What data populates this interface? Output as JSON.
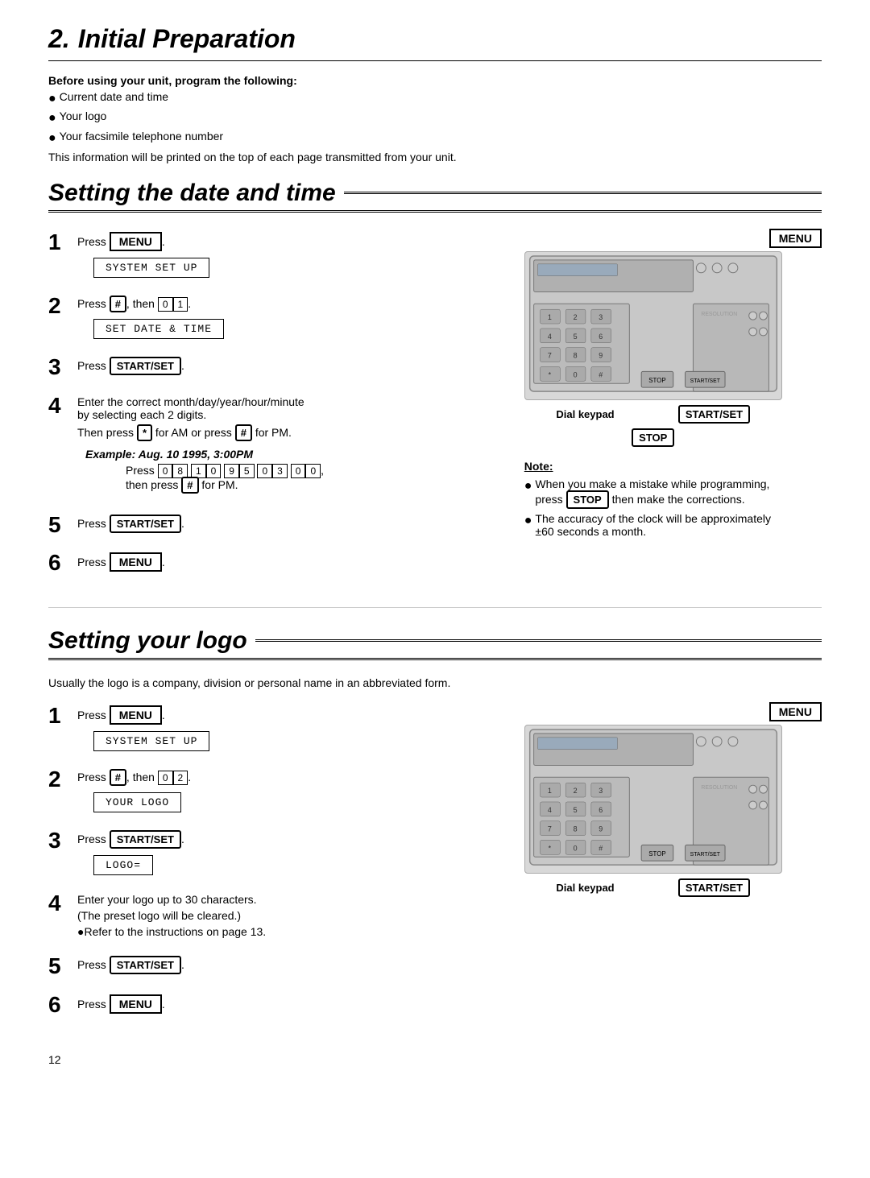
{
  "page": {
    "title_number": "2.",
    "title_text": "Initial Preparation",
    "page_number": "12"
  },
  "intro": {
    "bold_line": "Before using your unit, program the following:",
    "bullets": [
      "Current date and time",
      "Your logo",
      "Your facsimile telephone number"
    ],
    "body_text": "This information will be printed on the top of each page transmitted from your unit."
  },
  "section1": {
    "heading": "Setting the date and time",
    "steps": [
      {
        "number": "1",
        "text": "Press ",
        "highlight": "MENU",
        "highlight_type": "menu"
      },
      {
        "number": "2",
        "text": "Press ",
        "highlight": "#",
        "highlight_type": "kbd",
        "suffix": ", then ",
        "keys": [
          "0",
          "1"
        ],
        "lcd": "SYSTEM SET UP"
      },
      {
        "number": "3",
        "text": "Press ",
        "highlight": "START/SET",
        "highlight_type": "btn",
        "lcd": "SET DATE & TIME"
      },
      {
        "number": "4",
        "text": "Enter the correct month/day/year/hour/minute by selecting each 2 digits.",
        "sub": "Then press * for AM or press # for PM.",
        "example_title": "Example: Aug. 10 1995, 3:00PM",
        "example_digits": [
          "0",
          "8",
          "1",
          "0",
          "9",
          "5",
          "0",
          "3",
          "0",
          "0"
        ],
        "example_then": "then press ",
        "example_key": "#",
        "example_suffix": " for PM."
      },
      {
        "number": "5",
        "text": "Press ",
        "highlight": "START/SET",
        "highlight_type": "btn"
      },
      {
        "number": "6",
        "text": "Press ",
        "highlight": "MENU",
        "highlight_type": "menu"
      }
    ],
    "note": {
      "title": "Note:",
      "items": [
        "When you make a mistake while programming, press STOP then make the corrections.",
        "The accuracy of the clock will be approximately ±60 seconds a month."
      ]
    },
    "diagram_labels": {
      "dial_keypad": "Dial keypad",
      "start_set": "START/SET",
      "stop": "STOP",
      "menu": "MENU"
    }
  },
  "section2": {
    "heading": "Setting your logo",
    "intro": "Usually the logo is a company, division or personal name in an abbreviated form.",
    "steps": [
      {
        "number": "1",
        "text": "Press ",
        "highlight": "MENU",
        "highlight_type": "menu",
        "lcd": "SYSTEM SET UP"
      },
      {
        "number": "2",
        "text": "Press ",
        "highlight": "#",
        "highlight_type": "kbd",
        "suffix": ", then ",
        "keys": [
          "0",
          "2"
        ],
        "lcd": "YOUR LOGO"
      },
      {
        "number": "3",
        "text": "Press ",
        "highlight": "START/SET",
        "highlight_type": "btn",
        "lcd": "LOGO="
      },
      {
        "number": "4",
        "text": "Enter your logo up to 30 characters.",
        "sub": "(The preset logo will be cleared.)",
        "note_item": "●Refer to the instructions on page 13."
      },
      {
        "number": "5",
        "text": "Press ",
        "highlight": "START/SET",
        "highlight_type": "btn"
      },
      {
        "number": "6",
        "text": "Press ",
        "highlight": "MENU",
        "highlight_type": "menu"
      }
    ],
    "diagram_labels": {
      "dial_keypad": "Dial keypad",
      "start_set": "START/SET",
      "menu": "MENU"
    }
  }
}
